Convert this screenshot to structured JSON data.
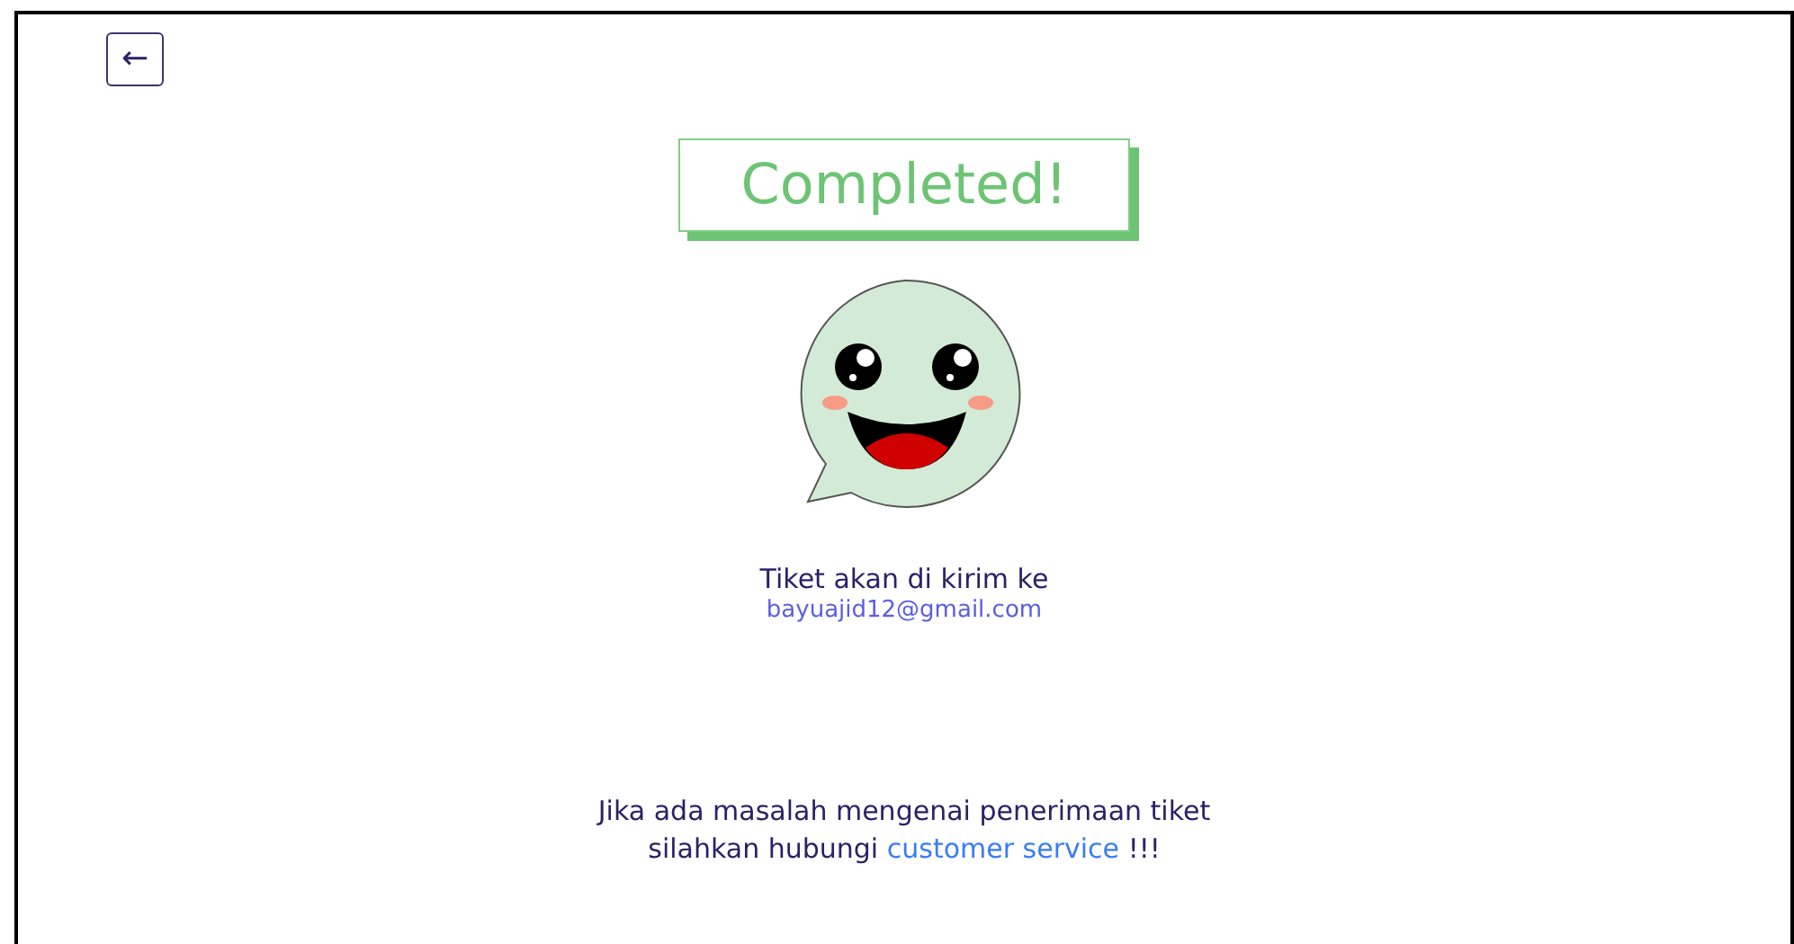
{
  "back_button": {
    "label": "←"
  },
  "status_badge": {
    "text": "Completed!"
  },
  "ticket_notice": {
    "text": "Tiket akan di kirim ke",
    "email": "bayuajid12@gmail.com"
  },
  "help_message": {
    "text_before": "Jika ada masalah mengenai penerimaan tiket silahkan hubungi",
    "link": "customer service",
    "text_after": "!!!"
  }
}
